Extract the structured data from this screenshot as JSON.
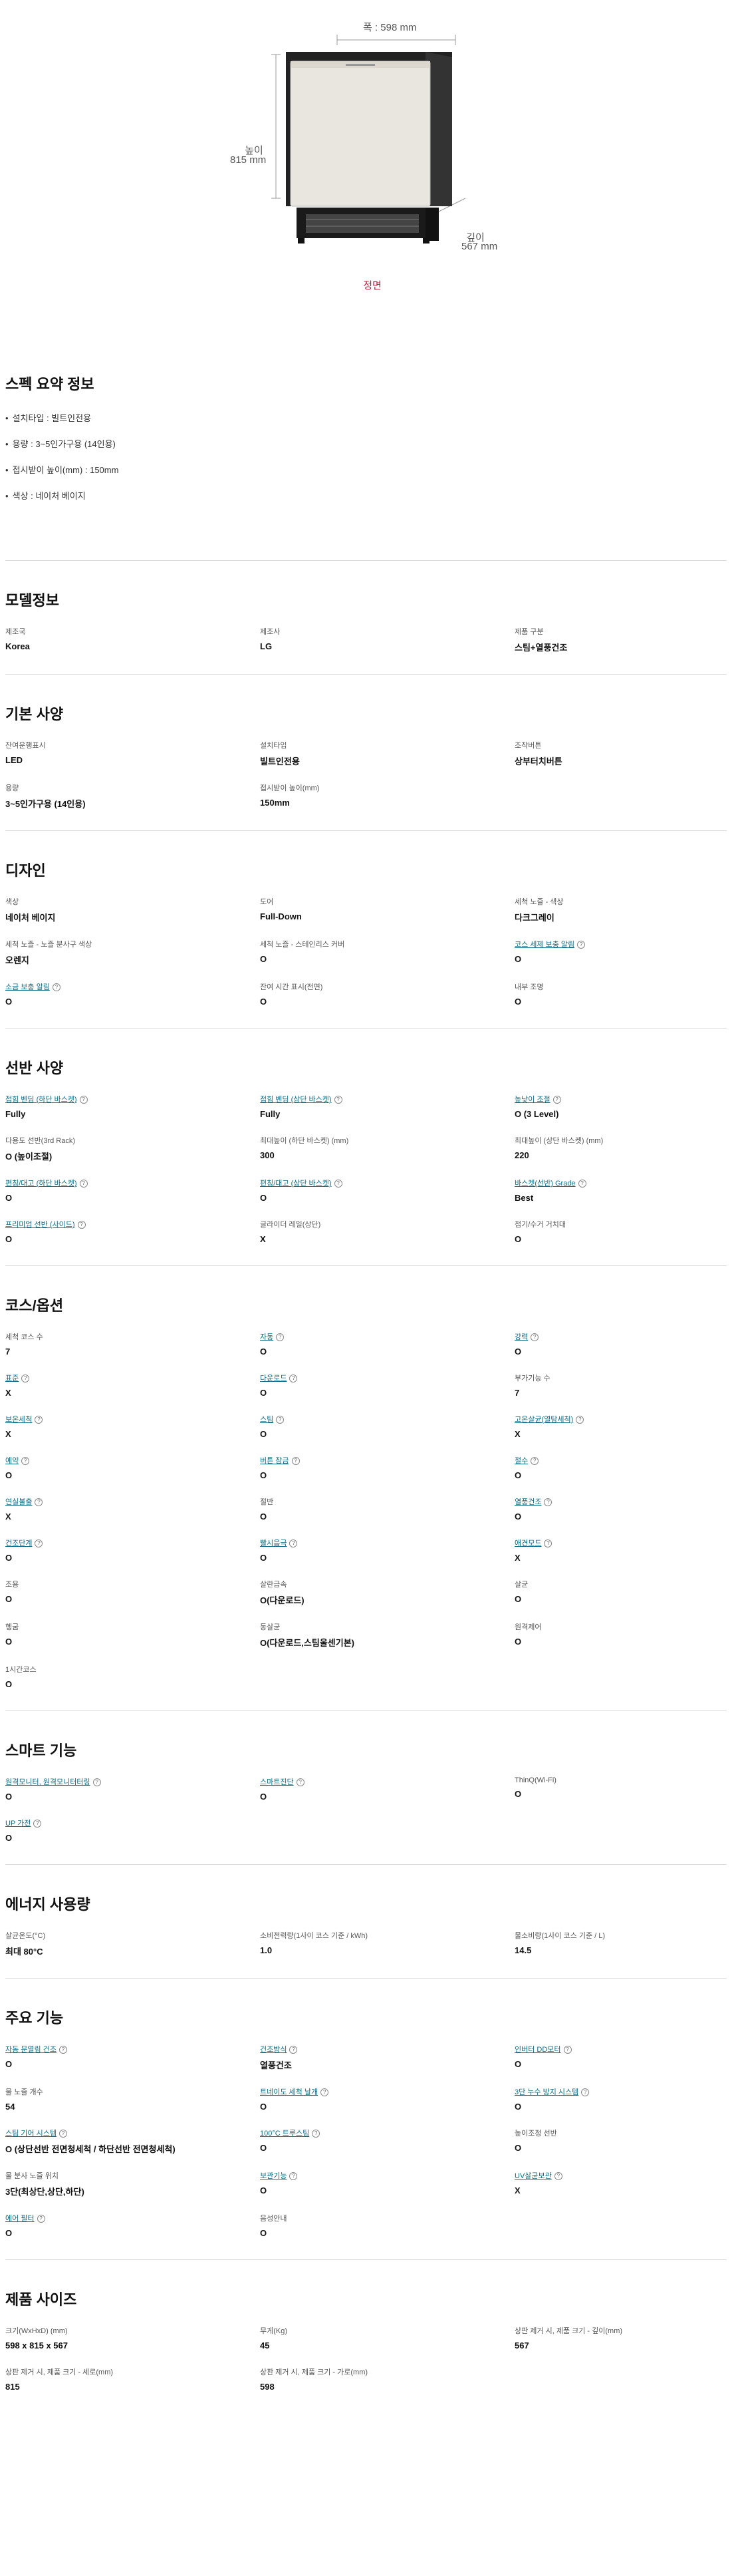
{
  "hero": {
    "width": "폭 : 598 mm",
    "height_label": "높이",
    "height_value": "815 mm",
    "depth_label": "깊이",
    "depth_value": "567 mm",
    "view_label": "정면"
  },
  "summary": {
    "title": "스펙 요약 정보",
    "items": [
      "설치타입 : 빌트인전용",
      "용량 : 3~5인가구용 (14인용)",
      "접시받이 높이(mm) : 150mm",
      "색상 : 네이처 베이지"
    ]
  },
  "sections": [
    {
      "title": "모델정보",
      "items": [
        {
          "label": "제조국",
          "value": "Korea",
          "link": false,
          "info": false
        },
        {
          "label": "제조사",
          "value": "LG",
          "link": false,
          "info": false
        },
        {
          "label": "제품 구분",
          "value": "스팀+열풍건조",
          "link": false,
          "info": false
        }
      ]
    },
    {
      "title": "기본 사양",
      "items": [
        {
          "label": "잔여운행표시",
          "value": "LED",
          "link": false,
          "info": false
        },
        {
          "label": "설치타입",
          "value": "빌트인전용",
          "link": false,
          "info": false
        },
        {
          "label": "조작버튼",
          "value": "상부터치버튼",
          "link": false,
          "info": false
        },
        {
          "label": "용량",
          "value": "3~5인가구용 (14인용)",
          "link": false,
          "info": false
        },
        {
          "label": "접시받이 높이(mm)",
          "value": "150mm",
          "link": false,
          "info": false
        }
      ]
    },
    {
      "title": "디자인",
      "items": [
        {
          "label": "색상",
          "value": "네이처 베이지",
          "link": false,
          "info": false
        },
        {
          "label": "도어",
          "value": "Full-Down",
          "link": false,
          "info": false
        },
        {
          "label": "세척 노즐 - 색상",
          "value": "다크그레이",
          "link": false,
          "info": false
        },
        {
          "label": "세척 노즐 - 노즐 분사구 색상",
          "value": "오렌지",
          "link": false,
          "info": false
        },
        {
          "label": "세척 노즐 - 스테인리스 커버",
          "value": "O",
          "link": false,
          "info": false
        },
        {
          "label": "코스 세제 보충 알림",
          "value": "O",
          "link": true,
          "info": true
        },
        {
          "label": "소금 보충 알림",
          "value": "O",
          "link": true,
          "info": true
        },
        {
          "label": "잔여 시간 표시(전면)",
          "value": "O",
          "link": false,
          "info": false
        },
        {
          "label": "내부 조명",
          "value": "O",
          "link": false,
          "info": false
        }
      ]
    },
    {
      "title": "선반 사양",
      "items": [
        {
          "label": "접힘 벤딩 (하단 바스켓)",
          "value": "Fully",
          "link": true,
          "info": true
        },
        {
          "label": "접힘 벤딩 (상단 바스켓)",
          "value": "Fully",
          "link": true,
          "info": true
        },
        {
          "label": "높낮이 조절",
          "value": "O (3 Level)",
          "link": true,
          "info": true
        },
        {
          "label": "다용도 선반(3rd Rack)",
          "value": "O (높이조절)",
          "link": false,
          "info": false
        },
        {
          "label": "최대높이 (하단 바스켓) (mm)",
          "value": "300",
          "link": false,
          "info": false
        },
        {
          "label": "최대높이 (상단 바스켓) (mm)",
          "value": "220",
          "link": false,
          "info": false
        },
        {
          "label": "편칭/대고 (하단 바스켓)",
          "value": "O",
          "link": true,
          "info": true
        },
        {
          "label": "편칭/대고 (상단 바스켓)",
          "value": "O",
          "link": true,
          "info": true
        },
        {
          "label": "바스켓(선반) Grade",
          "value": "Best",
          "link": true,
          "info": true
        },
        {
          "label": "프리미엄 선반 (사이드)",
          "value": "O",
          "link": true,
          "info": true
        },
        {
          "label": "글라이더 레일(상단)",
          "value": "X",
          "link": false,
          "info": false
        },
        {
          "label": "접기/수거 거치대",
          "value": "O",
          "link": false,
          "info": false
        }
      ]
    },
    {
      "title": "코스/옵션",
      "items": [
        {
          "label": "세척 코스 수",
          "value": "7",
          "link": false,
          "info": false
        },
        {
          "label": "자동",
          "value": "O",
          "link": true,
          "info": true
        },
        {
          "label": "강력",
          "value": "O",
          "link": true,
          "info": true
        },
        {
          "label": "표준",
          "value": "X",
          "link": true,
          "info": true
        },
        {
          "label": "다운로드",
          "value": "O",
          "link": true,
          "info": true
        },
        {
          "label": "부가기능 수",
          "value": "7",
          "link": false,
          "info": false
        },
        {
          "label": "보온세척",
          "value": "X",
          "link": true,
          "info": true
        },
        {
          "label": "스팀",
          "value": "O",
          "link": true,
          "info": true
        },
        {
          "label": "고온살균(열탕세척)",
          "value": "X",
          "link": true,
          "info": true
        },
        {
          "label": "예약",
          "value": "O",
          "link": true,
          "info": true
        },
        {
          "label": "버튼 잠금",
          "value": "O",
          "link": true,
          "info": true
        },
        {
          "label": "절수",
          "value": "O",
          "link": true,
          "info": true
        },
        {
          "label": "연실불출",
          "value": "X",
          "link": true,
          "info": true
        },
        {
          "label": "절반",
          "value": "O",
          "link": false,
          "info": false
        },
        {
          "label": "열풍건조",
          "value": "O",
          "link": true,
          "info": true
        },
        {
          "label": "건조단계",
          "value": "O",
          "link": true,
          "info": true
        },
        {
          "label": "빨시음극",
          "value": "O",
          "link": true,
          "info": true
        },
        {
          "label": "애견모드",
          "value": "X",
          "link": true,
          "info": true
        },
        {
          "label": "조용",
          "value": "O",
          "link": false,
          "info": false
        },
        {
          "label": "살란급속",
          "value": "O(다운로드)",
          "link": false,
          "info": false
        },
        {
          "label": "살균",
          "value": "O",
          "link": false,
          "info": false
        },
        {
          "label": "헹굼",
          "value": "O",
          "link": false,
          "info": false
        },
        {
          "label": "동살균",
          "value": "O(다운로드,스팀울센기본)",
          "link": false,
          "info": false
        },
        {
          "label": "원격제어",
          "value": "O",
          "link": false,
          "info": false
        },
        {
          "label": "1시간코스",
          "value": "O",
          "link": false,
          "info": false
        }
      ]
    },
    {
      "title": "스마트 기능",
      "items": [
        {
          "label": "원격모니터, 원격모니터터링",
          "value": "O",
          "link": true,
          "info": true
        },
        {
          "label": "스마트진단",
          "value": "O",
          "link": true,
          "info": true
        },
        {
          "label": "ThinQ(Wi-Fi)",
          "value": "O",
          "link": false,
          "info": false
        },
        {
          "label": "UP 가전",
          "value": "O",
          "link": true,
          "info": true
        }
      ]
    },
    {
      "title": "에너지 사용량",
      "items": [
        {
          "label": "살균온도(°C)",
          "value": "최대 80°C",
          "link": false,
          "info": false
        },
        {
          "label": "소비전력량(1사이 코스 기준 / kWh)",
          "value": "1.0",
          "link": false,
          "info": false
        },
        {
          "label": "물소비량(1사이 코스 기준 / L)",
          "value": "14.5",
          "link": false,
          "info": false
        }
      ]
    },
    {
      "title": "주요 기능",
      "items": [
        {
          "label": "자동 문열림 건조",
          "value": "O",
          "link": true,
          "info": true
        },
        {
          "label": "건조방식",
          "value": "열풍건조",
          "link": true,
          "info": true
        },
        {
          "label": "인버터 DD모터",
          "value": "O",
          "link": true,
          "info": true
        },
        {
          "label": "물 노즐 개수",
          "value": "54",
          "link": false,
          "info": false
        },
        {
          "label": "트네이도 세척 날개",
          "value": "O",
          "link": true,
          "info": true
        },
        {
          "label": "3단 누수 방지 시스템",
          "value": "O",
          "link": true,
          "info": true
        },
        {
          "label": "스팀 기어 시스템",
          "value": "O (상단선반 전면청세척 / 하단선반 전면청세척)",
          "link": true,
          "info": true
        },
        {
          "label": "100°C 트루스팀",
          "value": "O",
          "link": true,
          "info": true
        },
        {
          "label": "높이조정 선반",
          "value": "O",
          "link": false,
          "info": false
        },
        {
          "label": "물 분사 노즐 위치",
          "value": "3단(최상단,상단,하단)",
          "link": false,
          "info": false
        },
        {
          "label": "보관기능",
          "value": "O",
          "link": true,
          "info": true
        },
        {
          "label": "UV살균보관",
          "value": "X",
          "link": true,
          "info": true
        },
        {
          "label": "에어 필터",
          "value": "O",
          "link": true,
          "info": true
        },
        {
          "label": "음성안내",
          "value": "O",
          "link": false,
          "info": false
        }
      ]
    },
    {
      "title": "제품 사이즈",
      "items": [
        {
          "label": "크기(WxHxD) (mm)",
          "value": "598 x 815 x 567",
          "link": false,
          "info": false
        },
        {
          "label": "무게(Kg)",
          "value": "45",
          "link": false,
          "info": false
        },
        {
          "label": "상판 제거 시, 제품 크기 - 깊이(mm)",
          "value": "567",
          "link": false,
          "info": false
        },
        {
          "label": "상판 제거 시, 제품 크기 - 세로(mm)",
          "value": "815",
          "link": false,
          "info": false
        },
        {
          "label": "상판 제거 시, 제품 크기 - 가로(mm)",
          "value": "598",
          "link": false,
          "info": false
        }
      ]
    }
  ]
}
